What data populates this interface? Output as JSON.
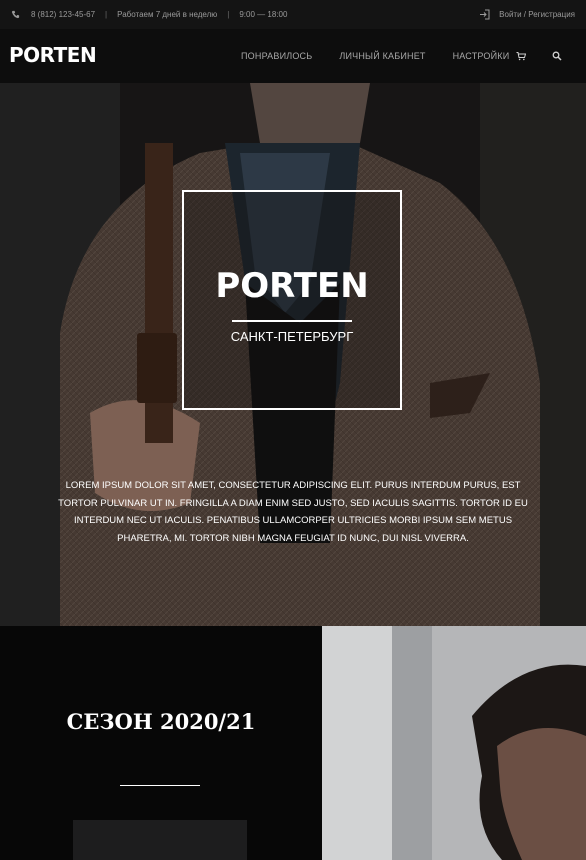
{
  "topbar": {
    "phone": "8 (812) 123-45-67",
    "hours_label": "Работаем 7 дней в неделю",
    "hours": "9:00 — 18:00",
    "login": "Войти / Регистрация",
    "icons": [
      "phone-icon",
      "login-icon"
    ]
  },
  "nav": {
    "logo": "PORTEN",
    "items": [
      "ПОНРАВИЛОСЬ",
      "ЛИЧНЫЙ КАБИНЕТ",
      "НАСТРОЙКИ"
    ],
    "icons": [
      "cart-icon",
      "search-icon"
    ]
  },
  "hero": {
    "brand": "PORTEN",
    "city": "САНКТ-ПЕТЕРБУРГ",
    "text": "LOREM IPSUM DOLOR SIT AMET, CONSECTETUR ADIPISCING ELIT. PURUS INTERDUM PURUS, EST TORTOR PULVINAR UT IN. FRINGILLA A DIAM ENIM SED JUSTO, SED IACULIS SAGITTIS. TORTOR ID EU INTERDUM NEC UT IACULIS. PENATIBUS ULLAMCORPER ULTRICIES MORBI IPSUM SEM METUS PHARETRA, MI. TORTOR NIBH MAGNA FEUGIAT ID NUNC, DUI NISL VIVERRA."
  },
  "season": {
    "title": "СЕЗОН 2020/21"
  },
  "colors": {
    "topbar_bg": "#141414",
    "nav_bg": "#0d0d0d",
    "accent": "#ffffff",
    "muted_text": "#a8a8a8"
  }
}
